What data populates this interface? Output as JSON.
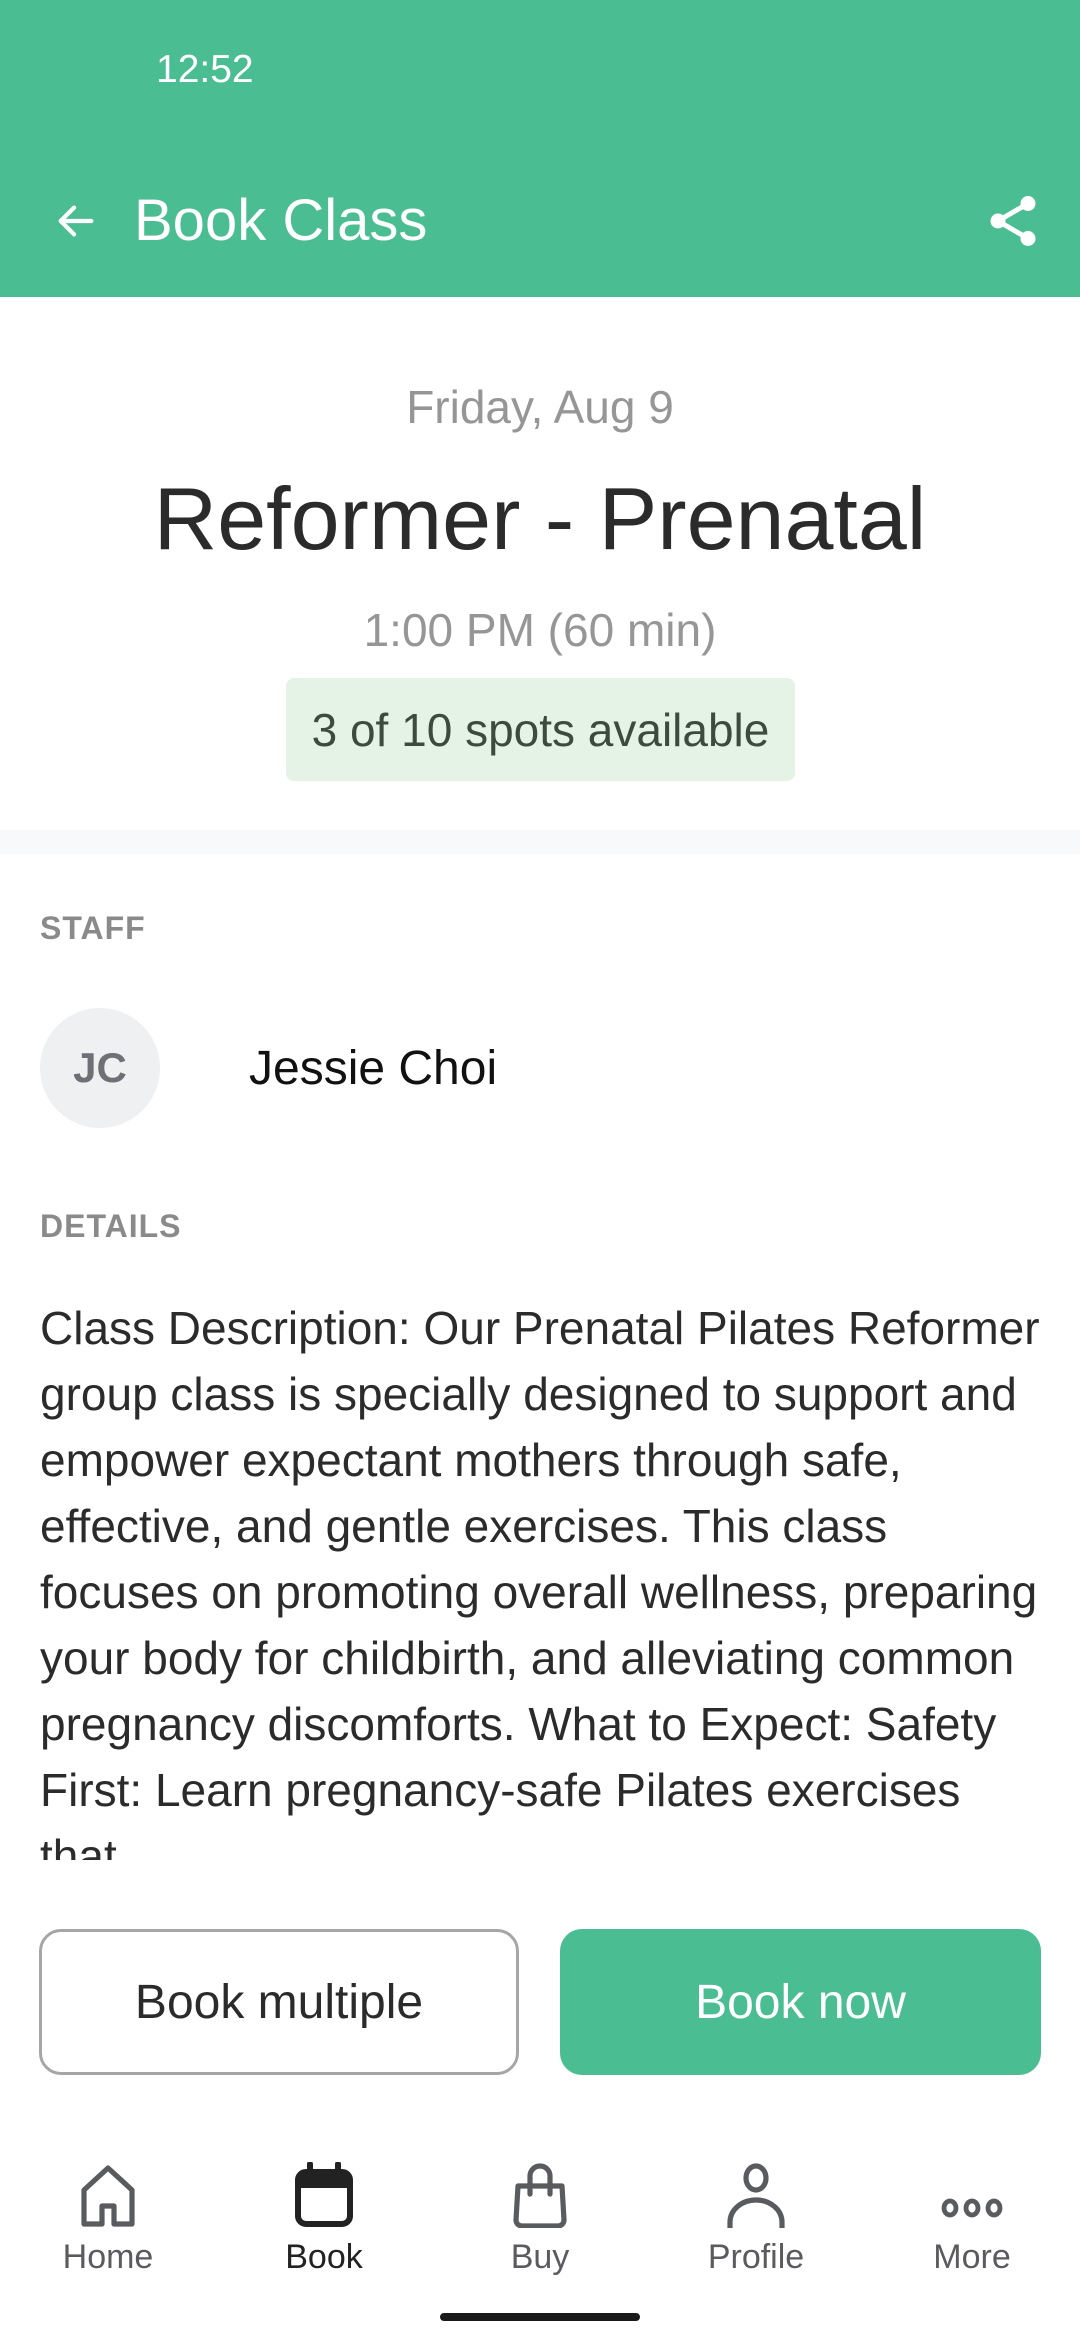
{
  "status_bar": {
    "time": "12:52"
  },
  "header": {
    "title": "Book Class",
    "back_icon": "arrow-left-icon",
    "share_icon": "share-icon",
    "color": "#4bbd93"
  },
  "class_info": {
    "date": "Friday, Aug 9",
    "title": "Reformer - Prenatal",
    "time": "1:00 PM (60 min)",
    "availability": "3 of 10 spots available",
    "spots_available": 3,
    "spots_total": 10
  },
  "staff": {
    "label": "STAFF",
    "initials": "JC",
    "name": "Jessie Choi"
  },
  "details": {
    "label": "DETAILS",
    "description": "Class Description: Our Prenatal Pilates Reformer group class is specially designed to support and empower expectant mothers through safe, effective, and gentle exercises. This class focuses on promoting overall wellness, preparing your body for childbirth, and alleviating common pregnancy discomforts. What to Expect: Safety First: Learn pregnancy-safe Pilates exercises that"
  },
  "actions": {
    "book_multiple": "Book multiple",
    "book_now": "Book now"
  },
  "nav": {
    "items": [
      {
        "label": "Home",
        "icon": "home-icon",
        "active": false
      },
      {
        "label": "Book",
        "icon": "calendar-icon",
        "active": true
      },
      {
        "label": "Buy",
        "icon": "shopping-bag-icon",
        "active": false
      },
      {
        "label": "Profile",
        "icon": "person-icon",
        "active": false
      },
      {
        "label": "More",
        "icon": "more-dots-icon",
        "active": false
      }
    ]
  }
}
